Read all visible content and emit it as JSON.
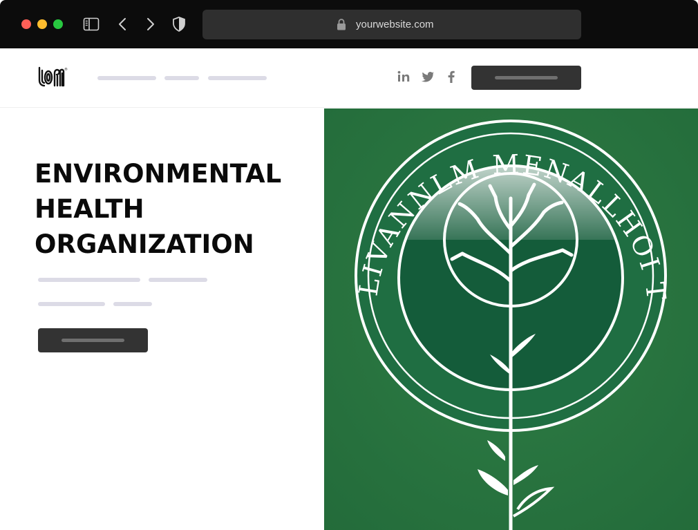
{
  "browser": {
    "url": "yourwebsite.com",
    "icons": [
      "sidebar-icon",
      "back-icon",
      "forward-icon",
      "shield-icon",
      "lock-icon"
    ]
  },
  "header": {
    "logo_alt": "logo",
    "social": [
      "linkedin-icon",
      "twitter-icon",
      "facebook-icon"
    ]
  },
  "hero": {
    "title_lines": [
      "ENVIRONMENTAL",
      "HEALTH",
      "ORGANIZATION"
    ],
    "seal_text": "LIVANNLM MENALLHOI TROITO"
  },
  "colors": {
    "chrome_bg": "#0c0c0c",
    "address_bg": "#2f2f2f",
    "placeholder": "#dcdbe6",
    "button": "#333333",
    "green": "#2a7a44",
    "dark_green": "#145c3a"
  }
}
